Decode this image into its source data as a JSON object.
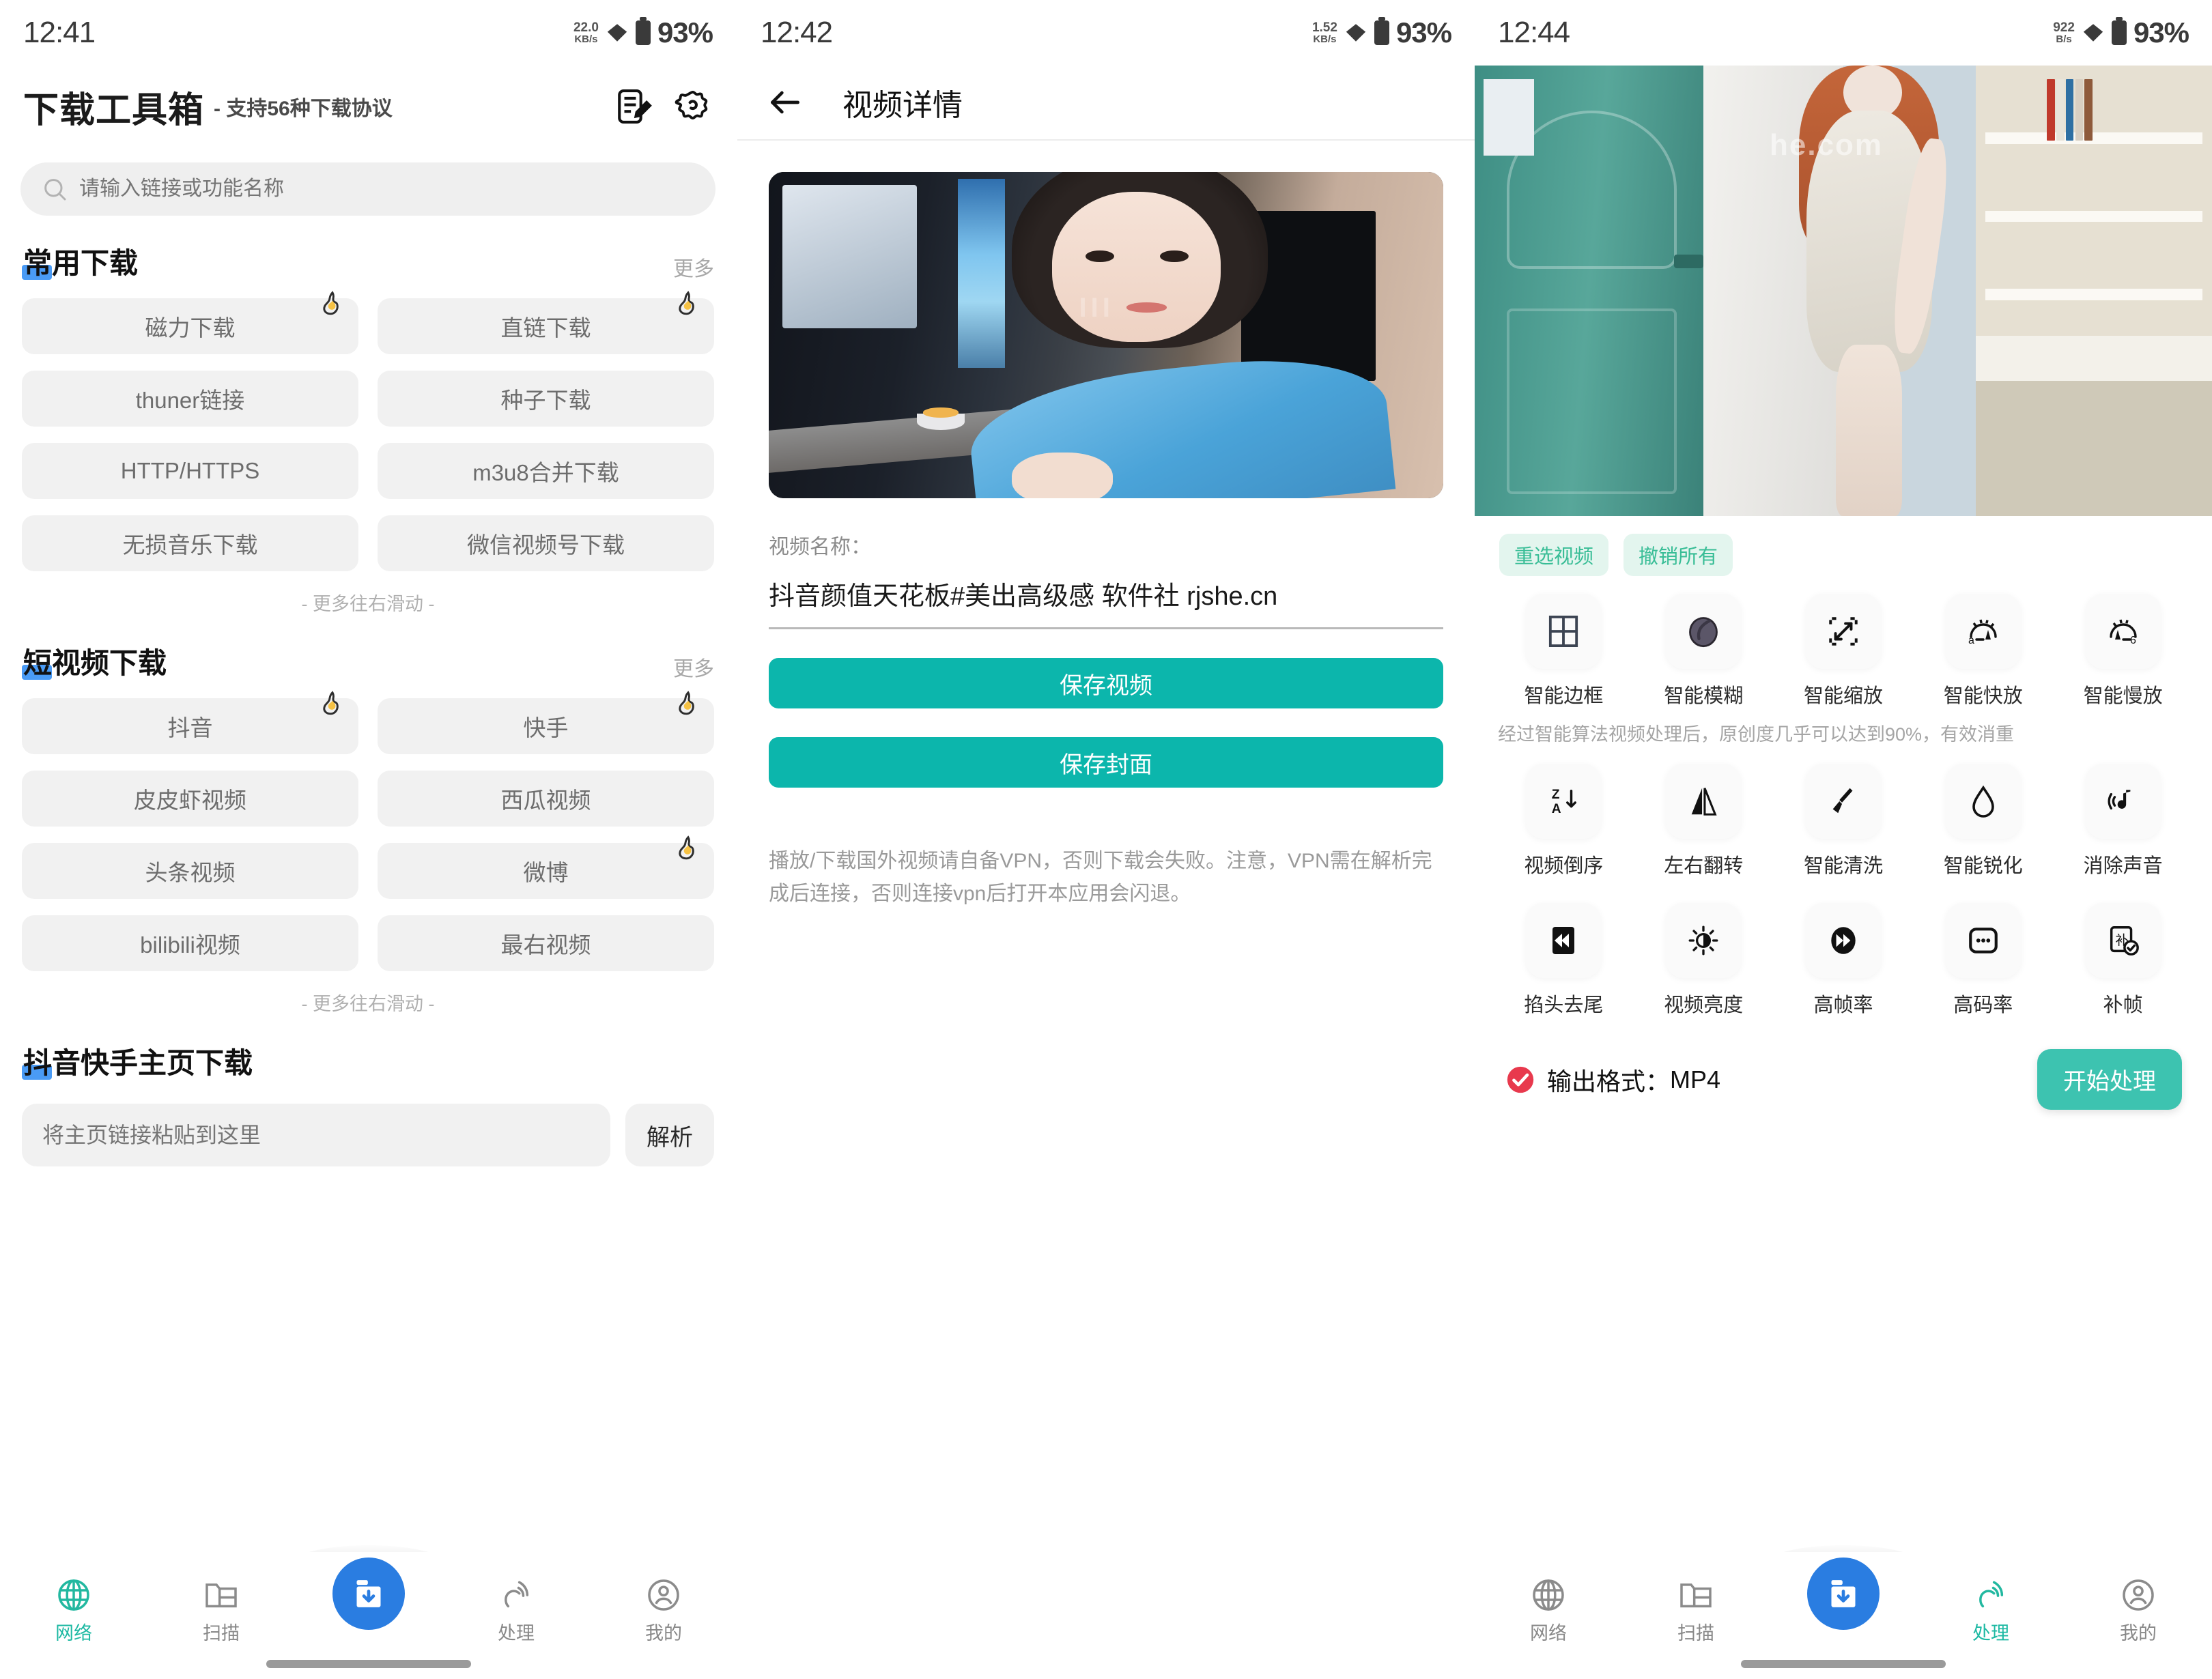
{
  "screen1": {
    "status": {
      "time": "12:41",
      "net_value": "22.0",
      "net_unit": "KB/s",
      "battery": "93%"
    },
    "header": {
      "title": "下载工具箱",
      "subtitle": "- 支持56种下载协议",
      "icon_note": "note-edit-icon",
      "icon_settings": "settings-icon"
    },
    "search": {
      "placeholder": "请输入链接或功能名称",
      "icon": "search-icon"
    },
    "sections": [
      {
        "title": "常用下载",
        "more": "更多",
        "hint": "- 更多往右滑动 -",
        "items": [
          {
            "label": "磁力下载",
            "hot": true
          },
          {
            "label": "直链下载",
            "hot": true
          },
          {
            "label": "thuner链接",
            "hot": false
          },
          {
            "label": "种子下载",
            "hot": false
          },
          {
            "label": "HTTP/HTTPS",
            "hot": false
          },
          {
            "label": "m3u8合并下载",
            "hot": false
          },
          {
            "label": "无损音乐下载",
            "hot": false
          },
          {
            "label": "微信视频号下载",
            "hot": false
          }
        ]
      },
      {
        "title": "短视频下载",
        "more": "更多",
        "hint": "- 更多往右滑动 -",
        "items": [
          {
            "label": "抖音",
            "hot": true
          },
          {
            "label": "快手",
            "hot": true
          },
          {
            "label": "皮皮虾视频",
            "hot": false
          },
          {
            "label": "西瓜视频",
            "hot": false
          },
          {
            "label": "头条视频",
            "hot": false
          },
          {
            "label": "微博",
            "hot": true
          },
          {
            "label": "bilibili视频",
            "hot": false
          },
          {
            "label": "最右视频",
            "hot": false
          }
        ]
      }
    ],
    "homepage_section": {
      "title": "抖音快手主页下载",
      "placeholder": "将主页链接粘贴到这里",
      "parse_button": "解析"
    },
    "nav": {
      "items": [
        {
          "label": "网络",
          "icon": "globe-icon",
          "active": true
        },
        {
          "label": "扫描",
          "icon": "folder-icon",
          "active": false
        },
        {
          "label": "",
          "icon": "download-box-icon",
          "active": false
        },
        {
          "label": "处理",
          "icon": "signal-icon",
          "active": false
        },
        {
          "label": "我的",
          "icon": "person-icon",
          "active": false
        }
      ]
    }
  },
  "screen2": {
    "status": {
      "time": "12:42",
      "net_value": "1.52",
      "net_unit": "KB/s",
      "battery": "93%"
    },
    "appbar": {
      "back_icon": "arrow-left-icon",
      "title": "视频详情"
    },
    "video_label": "视频名称：",
    "video_name": "抖音颜值天花板#美出高级感 软件社 rjshe.cn",
    "save_video_button": "保存视频",
    "save_cover_button": "保存封面",
    "note": "播放/下载国外视频请自备VPN，否则下载会失败。注意，VPN需在解析完成后连接，否则连接vpn后打开本应用会闪退。",
    "accent_color": "#0cb6ac"
  },
  "screen3": {
    "status": {
      "time": "12:44",
      "net_value": "922",
      "net_unit": "B/s",
      "battery": "93%"
    },
    "chips": [
      "重选视频",
      "撤销所有"
    ],
    "note": "经过智能算法视频处理后，原创度几乎可以达到90%，有效消重",
    "tools": [
      {
        "label": "智能边框",
        "icon": "frame-icon"
      },
      {
        "label": "智能模糊",
        "icon": "blur-icon"
      },
      {
        "label": "智能缩放",
        "icon": "resize-icon"
      },
      {
        "label": "智能快放",
        "icon": "speed-up-icon"
      },
      {
        "label": "智能慢放",
        "icon": "speed-down-icon"
      },
      {
        "label": "视频倒序",
        "icon": "sort-za-icon"
      },
      {
        "label": "左右翻转",
        "icon": "flip-horizontal-icon"
      },
      {
        "label": "智能清洗",
        "icon": "broom-icon"
      },
      {
        "label": "智能锐化",
        "icon": "droplet-icon"
      },
      {
        "label": "消除声音",
        "icon": "mute-note-icon"
      },
      {
        "label": "掐头去尾",
        "icon": "trim-icon"
      },
      {
        "label": "视频亮度",
        "icon": "brightness-icon"
      },
      {
        "label": "高帧率",
        "icon": "fast-forward-icon"
      },
      {
        "label": "高码率",
        "icon": "bitrate-icon"
      },
      {
        "label": "补帧",
        "icon": "add-frame-icon"
      }
    ],
    "output_format_label": "输出格式：",
    "output_format_value": "MP4",
    "output_check_color": "#e8394d",
    "start_button": "开始处理",
    "start_button_color": "#3dc3b0",
    "nav": {
      "items": [
        {
          "label": "网络",
          "icon": "globe-icon",
          "active": false
        },
        {
          "label": "扫描",
          "icon": "folder-icon",
          "active": false
        },
        {
          "label": "",
          "icon": "download-box-icon",
          "active": false
        },
        {
          "label": "处理",
          "icon": "signal-icon",
          "active": true
        },
        {
          "label": "我的",
          "icon": "person-icon",
          "active": false
        }
      ]
    }
  }
}
